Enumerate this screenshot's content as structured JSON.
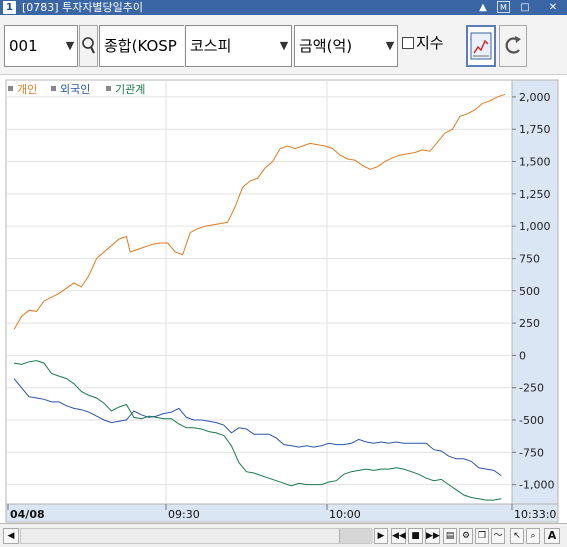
{
  "window": {
    "number": "1",
    "title": "[0783] 투자자별당일추이",
    "buttons": [
      "▲",
      "M",
      "□",
      "✕"
    ]
  },
  "toolbar": {
    "code": "001",
    "market": "종합(KOSP",
    "index": "코스피",
    "unit": "금액(억)",
    "index_checkbox_label": "지수",
    "index_checkbox_checked": false
  },
  "legend": [
    {
      "name": "개인",
      "color": "#e07a20"
    },
    {
      "name": "외국인",
      "color": "#2a54a8"
    },
    {
      "name": "기관계",
      "color": "#1a7a4c"
    }
  ],
  "chart_data": {
    "type": "line",
    "x_ticks": [
      "04/08",
      "09:30",
      "10:00",
      "10:33:0"
    ],
    "y_ticks": [
      "2,000",
      "1,750",
      "1,500",
      "1,250",
      "1,000",
      "750",
      "500",
      "250",
      "0",
      "-250",
      "-500",
      "-750",
      "-1,000"
    ],
    "ylim": [
      -1150,
      2100
    ],
    "xlim": [
      0,
      100
    ],
    "series": [
      {
        "name": "개인",
        "color": "#e07a20",
        "points": [
          [
            0,
            200
          ],
          [
            2,
            300
          ],
          [
            4,
            350
          ],
          [
            6,
            340
          ],
          [
            8,
            420
          ],
          [
            10,
            450
          ],
          [
            12,
            480
          ],
          [
            14,
            520
          ],
          [
            16,
            560
          ],
          [
            18,
            530
          ],
          [
            20,
            620
          ],
          [
            22,
            750
          ],
          [
            24,
            800
          ],
          [
            26,
            850
          ],
          [
            28,
            900
          ],
          [
            30,
            920
          ],
          [
            31,
            800
          ],
          [
            33,
            820
          ],
          [
            35,
            840
          ],
          [
            37,
            860
          ],
          [
            39,
            870
          ],
          [
            41,
            870
          ],
          [
            43,
            800
          ],
          [
            45,
            780
          ],
          [
            47,
            950
          ],
          [
            49,
            980
          ],
          [
            51,
            1000
          ],
          [
            53,
            1010
          ],
          [
            55,
            1020
          ],
          [
            57,
            1030
          ],
          [
            59,
            1150
          ],
          [
            61,
            1300
          ],
          [
            63,
            1350
          ],
          [
            65,
            1370
          ],
          [
            67,
            1450
          ],
          [
            69,
            1500
          ],
          [
            71,
            1600
          ],
          [
            73,
            1620
          ],
          [
            75,
            1600
          ],
          [
            77,
            1620
          ],
          [
            79,
            1640
          ],
          [
            81,
            1630
          ],
          [
            83,
            1620
          ],
          [
            85,
            1600
          ],
          [
            87,
            1550
          ],
          [
            89,
            1520
          ],
          [
            91,
            1510
          ],
          [
            93,
            1470
          ],
          [
            95,
            1440
          ],
          [
            97,
            1460
          ],
          [
            99,
            1500
          ],
          [
            101,
            1530
          ],
          [
            103,
            1550
          ],
          [
            105,
            1560
          ],
          [
            107,
            1570
          ],
          [
            109,
            1590
          ],
          [
            111,
            1580
          ],
          [
            113,
            1650
          ],
          [
            115,
            1720
          ],
          [
            117,
            1750
          ],
          [
            119,
            1850
          ],
          [
            121,
            1870
          ],
          [
            123,
            1900
          ],
          [
            125,
            1950
          ],
          [
            127,
            1970
          ],
          [
            129,
            2000
          ],
          [
            131,
            2020
          ]
        ]
      },
      {
        "name": "외국인",
        "color": "#2a54a8",
        "points": [
          [
            0,
            -180
          ],
          [
            2,
            -250
          ],
          [
            4,
            -320
          ],
          [
            6,
            -330
          ],
          [
            8,
            -340
          ],
          [
            10,
            -360
          ],
          [
            12,
            -360
          ],
          [
            14,
            -390
          ],
          [
            16,
            -410
          ],
          [
            18,
            -420
          ],
          [
            20,
            -440
          ],
          [
            22,
            -470
          ],
          [
            24,
            -500
          ],
          [
            26,
            -520
          ],
          [
            28,
            -510
          ],
          [
            30,
            -500
          ],
          [
            32,
            -430
          ],
          [
            34,
            -460
          ],
          [
            36,
            -480
          ],
          [
            38,
            -470
          ],
          [
            40,
            -450
          ],
          [
            42,
            -440
          ],
          [
            44,
            -410
          ],
          [
            46,
            -480
          ],
          [
            48,
            -500
          ],
          [
            50,
            -500
          ],
          [
            52,
            -510
          ],
          [
            54,
            -520
          ],
          [
            56,
            -540
          ],
          [
            58,
            -600
          ],
          [
            60,
            -560
          ],
          [
            62,
            -570
          ],
          [
            64,
            -610
          ],
          [
            66,
            -610
          ],
          [
            68,
            -610
          ],
          [
            70,
            -640
          ],
          [
            72,
            -690
          ],
          [
            74,
            -700
          ],
          [
            76,
            -710
          ],
          [
            78,
            -700
          ],
          [
            80,
            -710
          ],
          [
            82,
            -700
          ],
          [
            84,
            -680
          ],
          [
            86,
            -690
          ],
          [
            88,
            -690
          ],
          [
            90,
            -680
          ],
          [
            92,
            -650
          ],
          [
            94,
            -670
          ],
          [
            96,
            -680
          ],
          [
            98,
            -670
          ],
          [
            100,
            -680
          ],
          [
            102,
            -670
          ],
          [
            104,
            -680
          ],
          [
            106,
            -680
          ],
          [
            108,
            -680
          ],
          [
            110,
            -680
          ],
          [
            112,
            -730
          ],
          [
            114,
            -740
          ],
          [
            116,
            -780
          ],
          [
            118,
            -800
          ],
          [
            120,
            -800
          ],
          [
            122,
            -820
          ],
          [
            124,
            -870
          ],
          [
            126,
            -880
          ],
          [
            128,
            -890
          ],
          [
            130,
            -930
          ]
        ]
      },
      {
        "name": "기관계",
        "color": "#1a7a4c",
        "points": [
          [
            0,
            -60
          ],
          [
            2,
            -70
          ],
          [
            4,
            -50
          ],
          [
            6,
            -40
          ],
          [
            8,
            -60
          ],
          [
            10,
            -140
          ],
          [
            12,
            -160
          ],
          [
            14,
            -180
          ],
          [
            16,
            -220
          ],
          [
            18,
            -280
          ],
          [
            20,
            -310
          ],
          [
            22,
            -330
          ],
          [
            24,
            -370
          ],
          [
            26,
            -430
          ],
          [
            28,
            -400
          ],
          [
            30,
            -380
          ],
          [
            32,
            -480
          ],
          [
            34,
            -490
          ],
          [
            36,
            -470
          ],
          [
            38,
            -480
          ],
          [
            40,
            -490
          ],
          [
            42,
            -490
          ],
          [
            44,
            -530
          ],
          [
            46,
            -560
          ],
          [
            48,
            -560
          ],
          [
            50,
            -570
          ],
          [
            52,
            -590
          ],
          [
            54,
            -600
          ],
          [
            56,
            -620
          ],
          [
            58,
            -700
          ],
          [
            60,
            -830
          ],
          [
            62,
            -900
          ],
          [
            64,
            -910
          ],
          [
            66,
            -930
          ],
          [
            68,
            -950
          ],
          [
            70,
            -970
          ],
          [
            72,
            -990
          ],
          [
            74,
            -1010
          ],
          [
            76,
            -990
          ],
          [
            78,
            -1000
          ],
          [
            80,
            -1000
          ],
          [
            82,
            -1000
          ],
          [
            84,
            -980
          ],
          [
            86,
            -970
          ],
          [
            88,
            -920
          ],
          [
            90,
            -900
          ],
          [
            92,
            -890
          ],
          [
            94,
            -880
          ],
          [
            96,
            -890
          ],
          [
            98,
            -880
          ],
          [
            100,
            -880
          ],
          [
            102,
            -870
          ],
          [
            104,
            -880
          ],
          [
            106,
            -900
          ],
          [
            108,
            -920
          ],
          [
            110,
            -950
          ],
          [
            112,
            -970
          ],
          [
            114,
            -960
          ],
          [
            116,
            -1000
          ],
          [
            118,
            -1040
          ],
          [
            120,
            -1080
          ],
          [
            122,
            -1100
          ],
          [
            124,
            -1110
          ],
          [
            126,
            -1120
          ],
          [
            128,
            -1120
          ],
          [
            130,
            -1110
          ]
        ]
      }
    ]
  },
  "scrollbar": {
    "buttons": [
      "◀",
      "▶",
      "◀◀",
      "■",
      "▶▶",
      "A"
    ]
  }
}
